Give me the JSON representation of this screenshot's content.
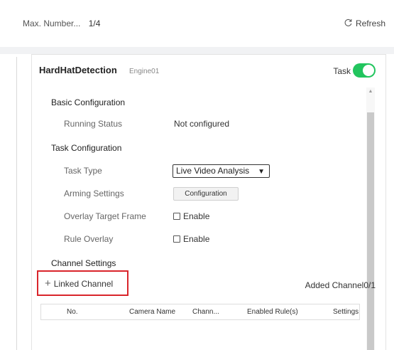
{
  "topbar": {
    "max_number_label": "Max. Number...",
    "max_number_value": "1/4",
    "refresh_label": "Refresh"
  },
  "card": {
    "title": "HardHatDetection",
    "engine": "Engine01",
    "task_label": "Task",
    "task_enabled": true
  },
  "basic": {
    "heading": "Basic Configuration",
    "running_status_label": "Running Status",
    "running_status_value": "Not configured"
  },
  "task_config": {
    "heading": "Task Configuration",
    "task_type_label": "Task Type",
    "task_type_value": "Live Video Analysis",
    "arming_label": "Arming Settings",
    "arming_button": "Configuration",
    "overlay_target_label": "Overlay Target Frame",
    "overlay_target_option": "Enable",
    "rule_overlay_label": "Rule Overlay",
    "rule_overlay_option": "Enable"
  },
  "channel": {
    "heading": "Channel Settings",
    "linked_label": "Linked Channel",
    "added_label": "Added Channel0/1",
    "columns": [
      "No.",
      "Camera Name",
      "Chann...",
      "Enabled Rule(s)",
      "Settings"
    ]
  },
  "colors": {
    "toggle_on": "#22c55e",
    "highlight": "#d9252b"
  },
  "icons": {
    "refresh": "refresh-icon",
    "plus": "plus-icon",
    "chevron": "chevron-down-icon"
  }
}
